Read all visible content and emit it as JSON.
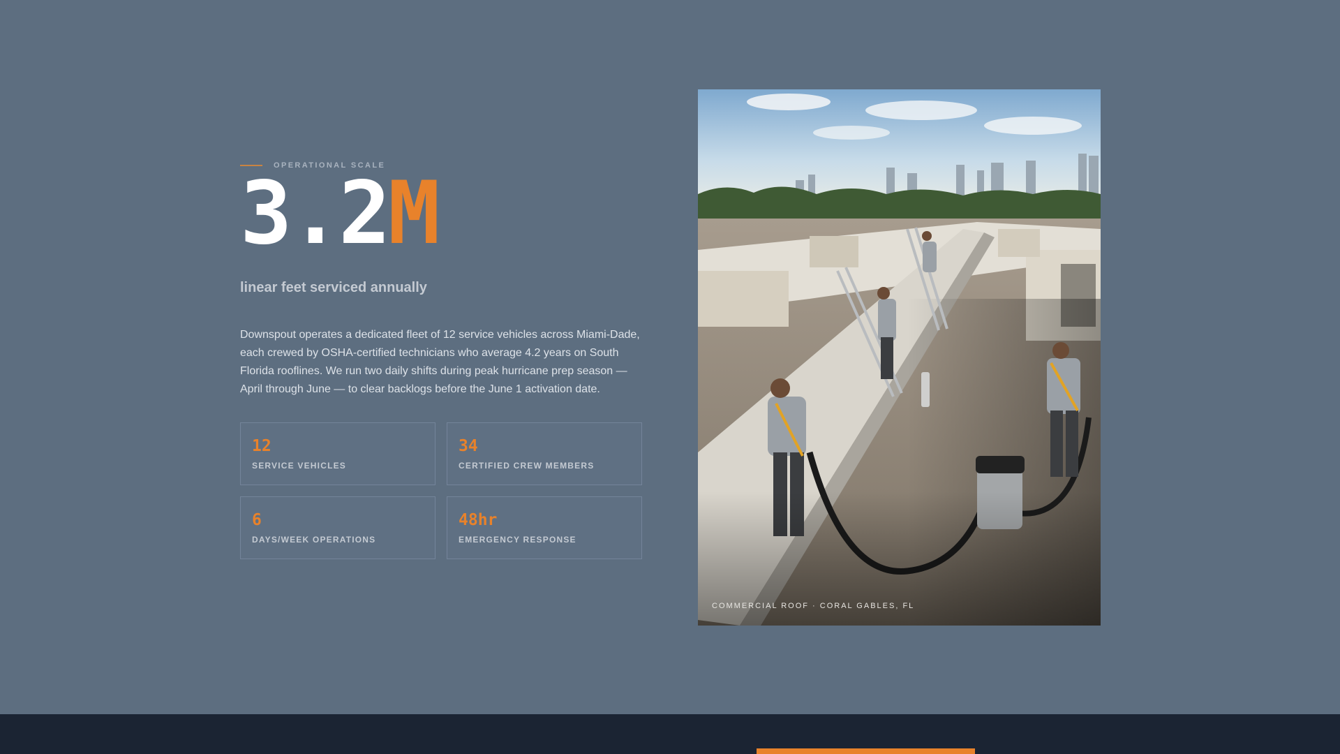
{
  "eyebrow": "OPERATIONAL SCALE",
  "headline": {
    "number": "3.2",
    "unit": "M"
  },
  "subtitle": "linear feet serviced annually",
  "description": "Downspout operates a dedicated fleet of 12 service vehicles across Miami-Dade, each crewed by OSHA-certified technicians who average 4.2 years on South Florida rooflines. We run two daily shifts during peak hurricane prep season — April through June — to clear backlogs before the June 1 activation date.",
  "stats": [
    {
      "value": "12",
      "label": "SERVICE VEHICLES"
    },
    {
      "value": "34",
      "label": "CERTIFIED CREW MEMBERS"
    },
    {
      "value": "6",
      "label": "DAYS/WEEK OPERATIONS"
    },
    {
      "value": "48hr",
      "label": "EMERGENCY RESPONSE"
    }
  ],
  "photo": {
    "caption": "COMMERCIAL ROOF · CORAL GABLES, FL"
  },
  "colors": {
    "accent": "#e8822b",
    "background": "#5d6e80",
    "footer": "#1b2433"
  }
}
